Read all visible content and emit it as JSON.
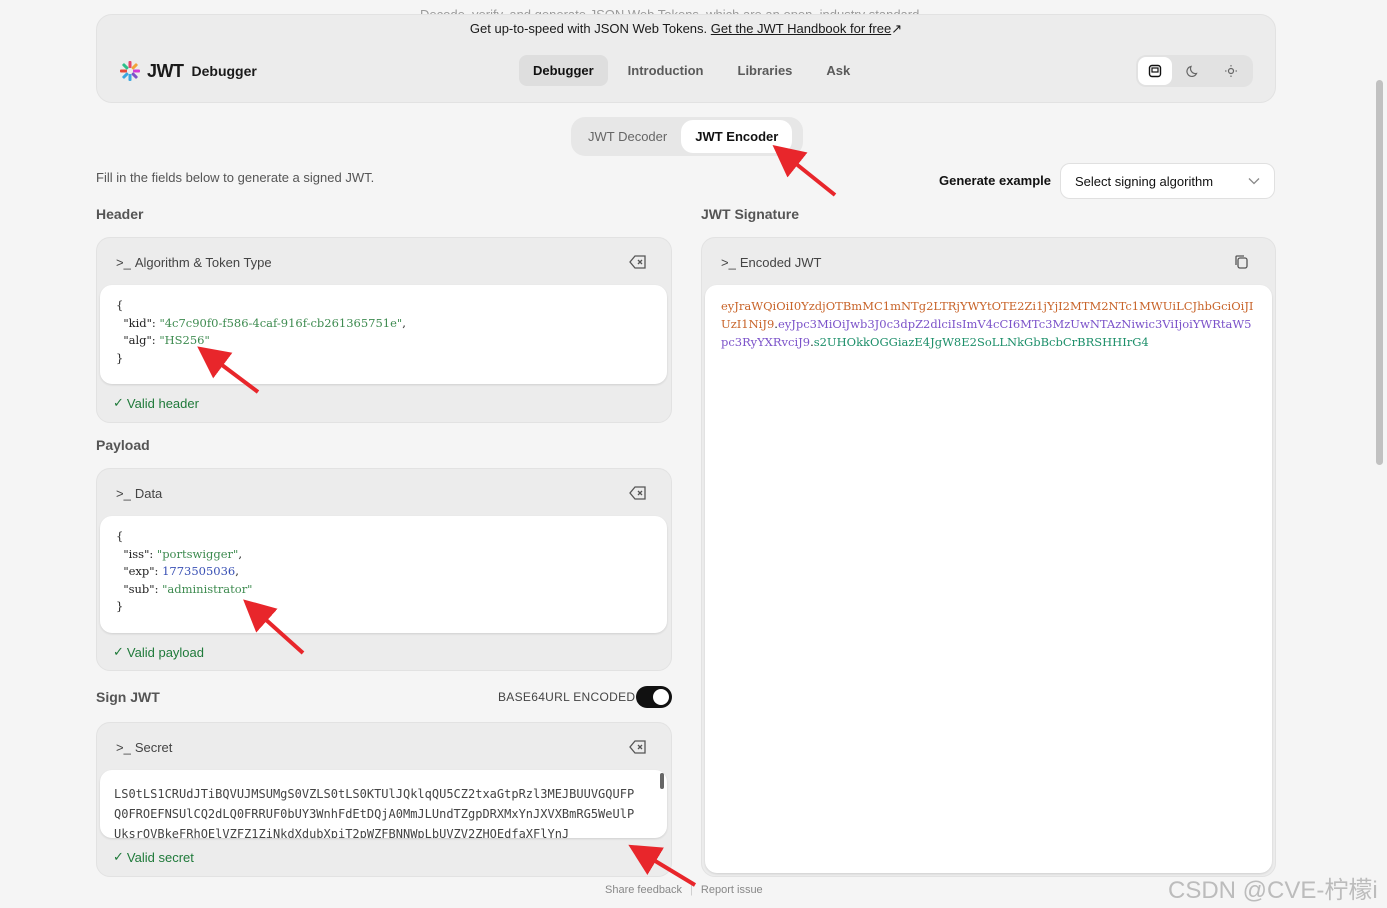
{
  "top_tagline": "Decode, verify, and generate JSON Web Tokens, which are an open, industry standard",
  "promo": {
    "text": "Get up-to-speed with JSON Web Tokens.",
    "link": "Get the JWT Handbook for free",
    "link_icon": "↗"
  },
  "brand": {
    "mark": "JWT",
    "product": "Debugger"
  },
  "nav": [
    "Debugger",
    "Introduction",
    "Libraries",
    "Ask"
  ],
  "mode_tabs": [
    "JWT Decoder",
    "JWT Encoder"
  ],
  "intro": "Fill in the fields below to generate a signed JWT.",
  "generate_example": {
    "label": "Generate example",
    "select": "Select signing algorithm"
  },
  "header_section": {
    "title": "Header",
    "panel_label": "Algorithm & Token Type",
    "kid_key": "\"kid\"",
    "kid_value": "\"4c7c90f0-f586-4caf-916f-cb261365751e\"",
    "alg_key": "\"alg\"",
    "alg_value": "\"HS256\"",
    "valid": "Valid header"
  },
  "payload_section": {
    "title": "Payload",
    "panel_label": "Data",
    "iss_key": "\"iss\"",
    "iss_value": "\"portswigger\"",
    "exp_key": "\"exp\"",
    "exp_value": "1773505036",
    "sub_key": "\"sub\"",
    "sub_value": "\"administrator\"",
    "valid": "Valid payload"
  },
  "sign_section": {
    "title": "Sign JWT",
    "encoding_label": "BASE64URL ENCODED",
    "panel_label": "Secret",
    "secret": "LS0tLS1CRUdJTiBQVUJMSUMgS0VZLS0tLS0KTUlJQklqQU5CZ2txaGtpRzl3MEJBUUVGQUFPQ0FROEFNSUlCQ2dLQ0FRRUF0bUY3WnhFdEtDQjA0MmJLUndTZgpDRXMxYnJXVXBmRG5WeUlPUksrOVBkeFRhOElVZFZ1ZiNkdXdubXpiT2pWZFBNNWpLbUVZV2ZHOEdfaXFlYnJ",
    "valid": "Valid secret"
  },
  "signature_section": {
    "title": "JWT Signature",
    "panel_label": "Encoded JWT",
    "header_part": "eyJraWQiOiI0YzdjOTBmMC1mNTg2LTRjYWYtOTE2Zi1jYjI2MTM2NTc1MWUiLCJhbGciOiJIUzI1NiJ9",
    "payload_part": "eyJpc3MiOiJwb3J0c3dpZ2dlciIsImV4cCI6MTc3MzUwNTAzNiwic3ViIjoiYWRtaW5pc3RyYXRvciJ9",
    "signature_part": "s2UHOkkOGGiazE4JgW8E2SoLLNkGbBcbCrBRSHHIrG4"
  },
  "footer": {
    "feedback": "Share feedback",
    "report": "Report issue"
  },
  "watermark": "CSDN @CVE-柠檬i",
  "colors": {
    "valid": "#1f7a3a",
    "string": "#3e8b50",
    "number": "#3950b4",
    "enc_header": "#c8642a",
    "enc_payload": "#7b52c9",
    "enc_signature": "#1d8f6a",
    "arrow": "#e8262b"
  }
}
